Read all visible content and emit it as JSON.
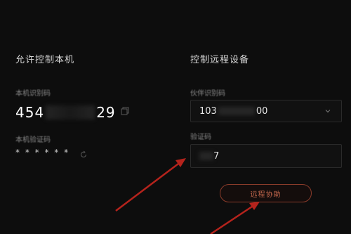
{
  "left": {
    "title": "允许控制本机",
    "id_label": "本机识别码",
    "id_prefix": "454",
    "id_suffix": "29",
    "password_label": "本机验证码",
    "password_value": "* * * * * *"
  },
  "right": {
    "title": "控制远程设备",
    "partner_label": "伙伴识别码",
    "partner_prefix": "103",
    "partner_suffix": "00",
    "code_label": "验证码",
    "code_suffix": "7",
    "assist_button": "远程协助"
  },
  "icons": {
    "copy": "copy-icon",
    "refresh": "refresh-icon",
    "dropdown": "chevron-down-icon"
  },
  "colors": {
    "background": "#0d0d0d",
    "accent_border": "#8a3b2a",
    "accent_text": "#c86a4e",
    "arrow": "#b5231c"
  }
}
